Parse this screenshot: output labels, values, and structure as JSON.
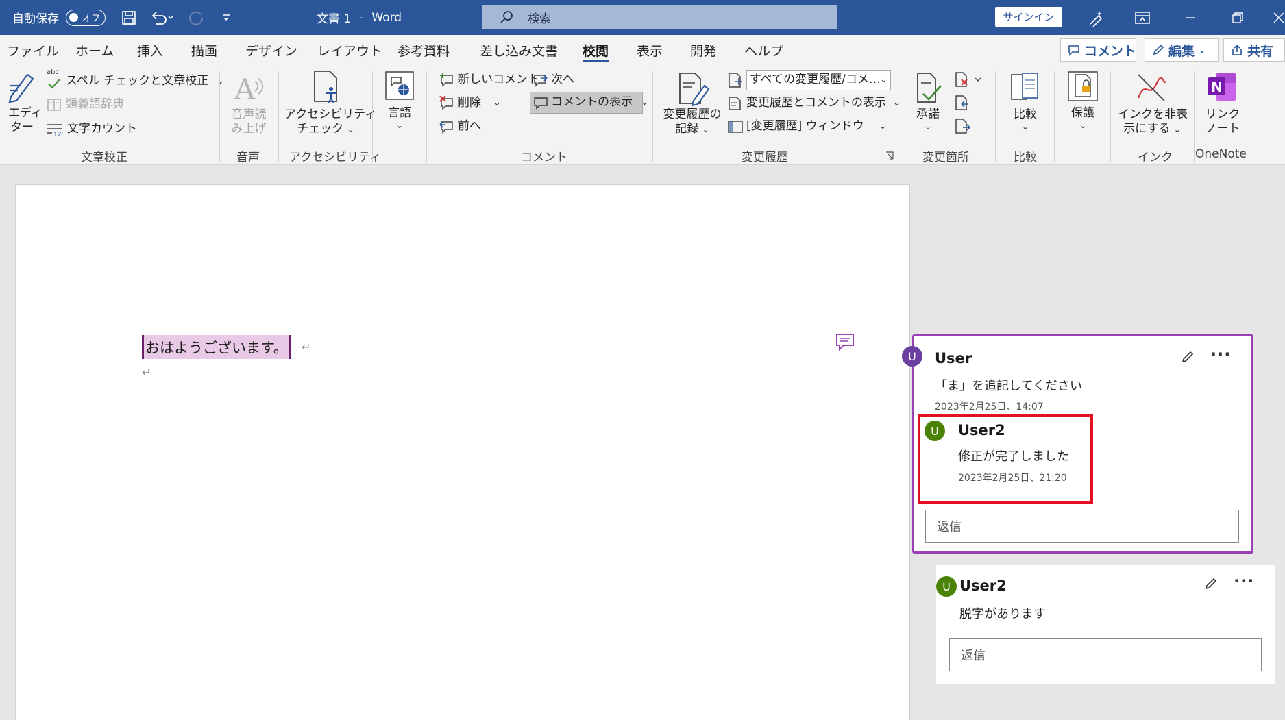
{
  "titlebar": {
    "autosave_label": "自動保存",
    "autosave_state": "オフ",
    "doc_title": "文書 1",
    "separator": "-",
    "app_name": "Word",
    "search_placeholder": "検索",
    "signin_label": "サインイン"
  },
  "menu": {
    "tabs": [
      "ファイル",
      "ホーム",
      "挿入",
      "描画",
      "デザイン",
      "レイアウト",
      "参考資料",
      "差し込み文書",
      "校閲",
      "表示",
      "開発",
      "ヘルプ"
    ],
    "active_tab": "校閲",
    "comment_button": "コメント",
    "edit_button": "編集",
    "share_button": "共有"
  },
  "ribbon": {
    "proofing": {
      "editor_line1": "エディ",
      "editor_line2": "ター",
      "spell_abc": "abc",
      "spell_check": "スペル チェックと文章校正",
      "thesaurus": "類義語辞典",
      "word_count": "文字カウント",
      "group_label": "文章校正"
    },
    "speech": {
      "read_aloud_line1": "音声読",
      "read_aloud_line2": "み上げ",
      "group_label": "音声"
    },
    "accessibility": {
      "check_line1": "アクセシビリティ",
      "check_line2": "チェック",
      "group_label": "アクセシビリティ"
    },
    "language": {
      "label": "言語"
    },
    "comments": {
      "new_comment": "新しいコメント",
      "delete": "削除",
      "previous": "前へ",
      "next": "次へ",
      "show_comments": "コメントの表示",
      "group_label": "コメント"
    },
    "tracking": {
      "track_changes_line1": "変更履歴の",
      "track_changes_line2": "記録",
      "markup_dropdown": "すべての変更履歴/コメ…",
      "show_markup": "変更履歴とコメントの表示",
      "reviewing_pane": "[変更履歴] ウィンドウ",
      "group_label": "変更履歴"
    },
    "changes": {
      "accept": "承諾",
      "group_label": "変更箇所"
    },
    "compare": {
      "label": "比較",
      "group_label": "比較"
    },
    "protect": {
      "label": "保護"
    },
    "ink": {
      "hide_ink_line1": "インクを非表",
      "hide_ink_line2": "示にする",
      "group_label": "インク"
    },
    "onenote": {
      "linked_notes_line1": "リンク",
      "linked_notes_line2": "ノート",
      "group_label": "OneNote"
    }
  },
  "document": {
    "text": "おはようございます。",
    "para_mark": "↵"
  },
  "comments": [
    {
      "avatar": "U",
      "author": "User",
      "body": "「ま」を追記してください",
      "date": "2023年2月25日、14:07",
      "reply": {
        "avatar": "U",
        "author": "User2",
        "body": "修正が完了しました",
        "date": "2023年2月25日、21:20"
      },
      "reply_placeholder": "返信"
    },
    {
      "avatar": "U",
      "author": "User2",
      "body": "脱字があります",
      "reply_placeholder": "返信"
    }
  ],
  "colors": {
    "titlebar": "#2b579a",
    "highlight": "#e8c9e6",
    "active_comment_border": "#9b3fb4",
    "red_annotation": "#e3111f",
    "avatar_user": "#6b3fa0",
    "avatar_user2": "#498205"
  }
}
